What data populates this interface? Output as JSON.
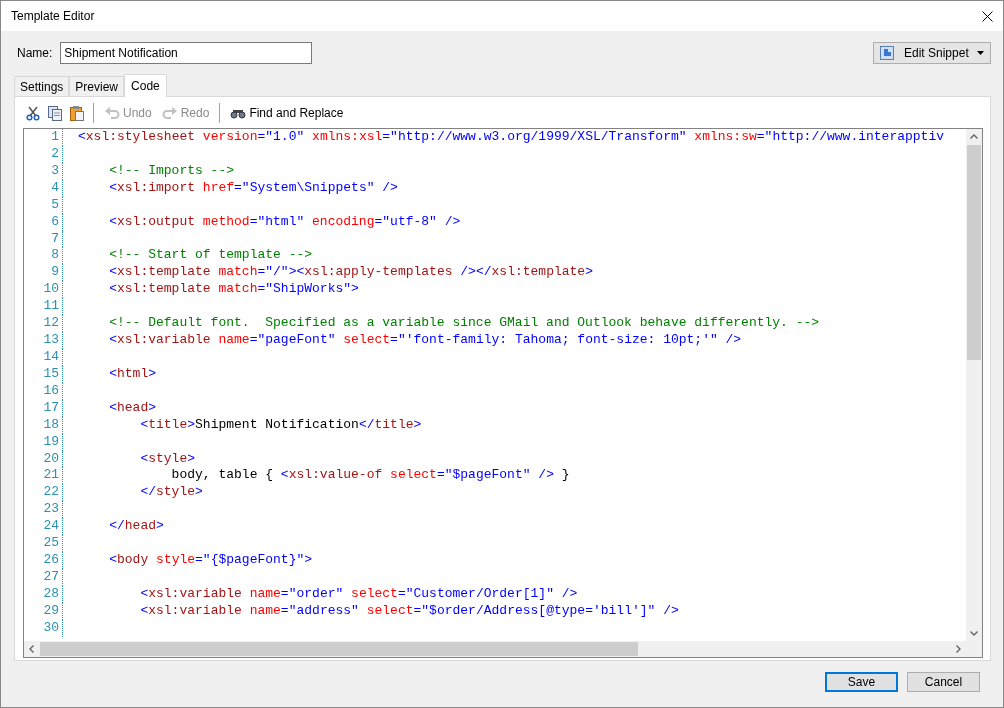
{
  "window": {
    "title": "Template Editor"
  },
  "name_field": {
    "label": "Name:",
    "value": "Shipment Notification"
  },
  "snippet_button": {
    "label": "Edit Snippet"
  },
  "tabs": [
    {
      "label": "Settings",
      "selected": false
    },
    {
      "label": "Preview",
      "selected": false
    },
    {
      "label": "Code",
      "selected": true
    }
  ],
  "toolbar": [
    {
      "kind": "cut",
      "disabled": false
    },
    {
      "kind": "copy",
      "disabled": false
    },
    {
      "kind": "paste",
      "disabled": false
    },
    {
      "kind": "separator"
    },
    {
      "kind": "undo",
      "label": "Undo",
      "disabled": true
    },
    {
      "kind": "redo",
      "label": "Redo",
      "disabled": true
    },
    {
      "kind": "separator"
    },
    {
      "kind": "find",
      "label": "Find and Replace",
      "disabled": false
    }
  ],
  "editor": {
    "lines": [
      {
        "number": "1",
        "tokens": [
          {
            "kind": "punct",
            "text": "<"
          },
          {
            "kind": "tag",
            "text": "xsl:stylesheet"
          },
          {
            "kind": "attr",
            "text": " version"
          },
          {
            "kind": "punct",
            "text": "="
          },
          {
            "kind": "value",
            "text": "\"1.0\""
          },
          {
            "kind": "attr",
            "text": " xmlns:xsl"
          },
          {
            "kind": "punct",
            "text": "="
          },
          {
            "kind": "value",
            "text": "\"http://www.w3.org/1999/XSL/Transform\""
          },
          {
            "kind": "attr",
            "text": " xmlns:sw"
          },
          {
            "kind": "punct",
            "text": "="
          },
          {
            "kind": "value",
            "text": "\"http://www.interapptiv"
          }
        ]
      },
      {
        "number": "2"
      },
      {
        "number": "3",
        "tokens": [
          {
            "kind": "comment",
            "text": "    <!-- Imports -->"
          }
        ]
      },
      {
        "number": "4",
        "tokens": [
          {
            "kind": "punct",
            "text": "    <"
          },
          {
            "kind": "tag",
            "text": "xsl:import"
          },
          {
            "kind": "attr",
            "text": " href"
          },
          {
            "kind": "punct",
            "text": "="
          },
          {
            "kind": "value",
            "text": "\"System\\Snippets\""
          },
          {
            "kind": "punct",
            "text": " />"
          }
        ]
      },
      {
        "number": "5"
      },
      {
        "number": "6",
        "tokens": [
          {
            "kind": "punct",
            "text": "    <"
          },
          {
            "kind": "tag",
            "text": "xsl:output"
          },
          {
            "kind": "attr",
            "text": " method"
          },
          {
            "kind": "punct",
            "text": "="
          },
          {
            "kind": "value",
            "text": "\"html\""
          },
          {
            "kind": "attr",
            "text": " encoding"
          },
          {
            "kind": "punct",
            "text": "="
          },
          {
            "kind": "value",
            "text": "\"utf-8\""
          },
          {
            "kind": "punct",
            "text": " />"
          }
        ]
      },
      {
        "number": "7"
      },
      {
        "number": "8",
        "tokens": [
          {
            "kind": "comment",
            "text": "    <!-- Start of template -->"
          }
        ]
      },
      {
        "number": "9",
        "tokens": [
          {
            "kind": "punct",
            "text": "    <"
          },
          {
            "kind": "tag",
            "text": "xsl:template"
          },
          {
            "kind": "attr",
            "text": " match"
          },
          {
            "kind": "punct",
            "text": "="
          },
          {
            "kind": "value",
            "text": "\"/\""
          },
          {
            "kind": "punct",
            "text": "><"
          },
          {
            "kind": "tag",
            "text": "xsl:apply-templates"
          },
          {
            "kind": "punct",
            "text": " /></"
          },
          {
            "kind": "tag",
            "text": "xsl:template"
          },
          {
            "kind": "punct",
            "text": ">"
          }
        ]
      },
      {
        "number": "10",
        "tokens": [
          {
            "kind": "punct",
            "text": "    <"
          },
          {
            "kind": "tag",
            "text": "xsl:template"
          },
          {
            "kind": "attr",
            "text": " match"
          },
          {
            "kind": "punct",
            "text": "="
          },
          {
            "kind": "value",
            "text": "\"ShipWorks\""
          },
          {
            "kind": "punct",
            "text": ">"
          }
        ]
      },
      {
        "number": "11"
      },
      {
        "number": "12",
        "tokens": [
          {
            "kind": "comment",
            "text": "    <!-- Default font.  Specified as a variable since GMail and Outlook behave differently. -->"
          }
        ]
      },
      {
        "number": "13",
        "tokens": [
          {
            "kind": "punct",
            "text": "    <"
          },
          {
            "kind": "tag",
            "text": "xsl:variable"
          },
          {
            "kind": "attr",
            "text": " name"
          },
          {
            "kind": "punct",
            "text": "="
          },
          {
            "kind": "value",
            "text": "\"pageFont\""
          },
          {
            "kind": "attr",
            "text": " select"
          },
          {
            "kind": "punct",
            "text": "="
          },
          {
            "kind": "value",
            "text": "\"'font-family: Tahoma; font-size: 10pt;'\""
          },
          {
            "kind": "punct",
            "text": " />"
          }
        ]
      },
      {
        "number": "14"
      },
      {
        "number": "15",
        "tokens": [
          {
            "kind": "punct",
            "text": "    <"
          },
          {
            "kind": "tag",
            "text": "html"
          },
          {
            "kind": "punct",
            "text": ">"
          }
        ]
      },
      {
        "number": "16"
      },
      {
        "number": "17",
        "tokens": [
          {
            "kind": "punct",
            "text": "    <"
          },
          {
            "kind": "tag",
            "text": "head"
          },
          {
            "kind": "punct",
            "text": ">"
          }
        ]
      },
      {
        "number": "18",
        "tokens": [
          {
            "kind": "punct",
            "text": "        <"
          },
          {
            "kind": "tag",
            "text": "title"
          },
          {
            "kind": "punct",
            "text": ">"
          },
          {
            "kind": "text",
            "text": "Shipment Notification"
          },
          {
            "kind": "punct",
            "text": "</"
          },
          {
            "kind": "tag",
            "text": "title"
          },
          {
            "kind": "punct",
            "text": ">"
          }
        ]
      },
      {
        "number": "19"
      },
      {
        "number": "20",
        "tokens": [
          {
            "kind": "punct",
            "text": "        <"
          },
          {
            "kind": "tag",
            "text": "style"
          },
          {
            "kind": "punct",
            "text": ">"
          }
        ]
      },
      {
        "number": "21",
        "tokens": [
          {
            "kind": "text",
            "text": "            body, table { "
          },
          {
            "kind": "punct",
            "text": "<"
          },
          {
            "kind": "tag",
            "text": "xsl:value-of"
          },
          {
            "kind": "attr",
            "text": " select"
          },
          {
            "kind": "punct",
            "text": "="
          },
          {
            "kind": "value",
            "text": "\"$pageFont\""
          },
          {
            "kind": "punct",
            "text": " />"
          },
          {
            "kind": "text",
            "text": " }"
          }
        ]
      },
      {
        "number": "22",
        "tokens": [
          {
            "kind": "punct",
            "text": "        </"
          },
          {
            "kind": "tag",
            "text": "style"
          },
          {
            "kind": "punct",
            "text": ">"
          }
        ]
      },
      {
        "number": "23"
      },
      {
        "number": "24",
        "tokens": [
          {
            "kind": "punct",
            "text": "    </"
          },
          {
            "kind": "tag",
            "text": "head"
          },
          {
            "kind": "punct",
            "text": ">"
          }
        ]
      },
      {
        "number": "25"
      },
      {
        "number": "26",
        "tokens": [
          {
            "kind": "punct",
            "text": "    <"
          },
          {
            "kind": "tag",
            "text": "body"
          },
          {
            "kind": "attr",
            "text": " style"
          },
          {
            "kind": "punct",
            "text": "="
          },
          {
            "kind": "value",
            "text": "\"{$pageFont}\""
          },
          {
            "kind": "punct",
            "text": ">"
          }
        ]
      },
      {
        "number": "27"
      },
      {
        "number": "28",
        "tokens": [
          {
            "kind": "punct",
            "text": "        <"
          },
          {
            "kind": "tag",
            "text": "xsl:variable"
          },
          {
            "kind": "attr",
            "text": " name"
          },
          {
            "kind": "punct",
            "text": "="
          },
          {
            "kind": "value",
            "text": "\"order\""
          },
          {
            "kind": "attr",
            "text": " select"
          },
          {
            "kind": "punct",
            "text": "="
          },
          {
            "kind": "value",
            "text": "\"Customer/Order[1]\""
          },
          {
            "kind": "punct",
            "text": " />"
          }
        ]
      },
      {
        "number": "29",
        "tokens": [
          {
            "kind": "punct",
            "text": "        <"
          },
          {
            "kind": "tag",
            "text": "xsl:variable"
          },
          {
            "kind": "attr",
            "text": " name"
          },
          {
            "kind": "punct",
            "text": "="
          },
          {
            "kind": "value",
            "text": "\"address\""
          },
          {
            "kind": "attr",
            "text": " select"
          },
          {
            "kind": "punct",
            "text": "="
          },
          {
            "kind": "value",
            "text": "\"$order/Address[@type='bill']\""
          },
          {
            "kind": "punct",
            "text": " />"
          }
        ]
      },
      {
        "number": "30"
      }
    ]
  },
  "buttons": [
    {
      "label": "Save",
      "kind": "default"
    },
    {
      "label": "Cancel",
      "kind": "normal"
    }
  ]
}
